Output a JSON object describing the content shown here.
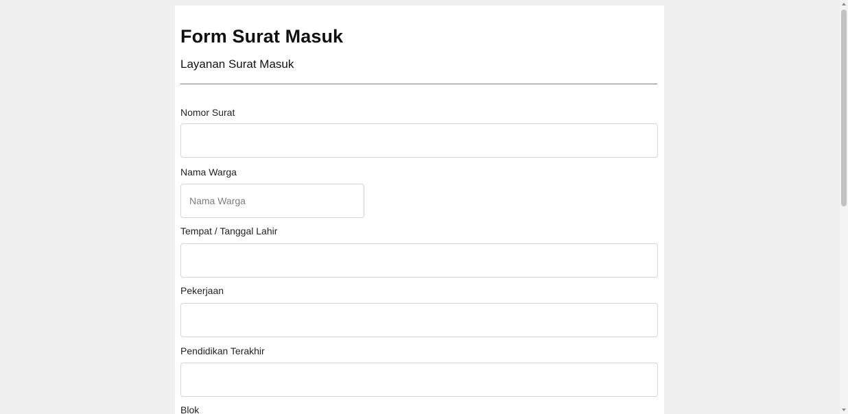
{
  "form": {
    "title": "Form Surat Masuk",
    "subtitle": "Layanan Surat Masuk",
    "fields": [
      {
        "label": "Nomor Surat",
        "value": "",
        "placeholder": ""
      },
      {
        "label": "Nama Warga",
        "value": "",
        "placeholder": "Nama Warga"
      },
      {
        "label": "Tempat / Tanggal Lahir",
        "value": "",
        "placeholder": ""
      },
      {
        "label": "Pekerjaan",
        "value": "",
        "placeholder": ""
      },
      {
        "label": "Pendidikan Terakhir",
        "value": "",
        "placeholder": ""
      },
      {
        "label": "Blok"
      }
    ]
  },
  "colors": {
    "page_background": "#f0f0f0",
    "card_background": "#ffffff",
    "input_border": "#d6d6d6"
  }
}
